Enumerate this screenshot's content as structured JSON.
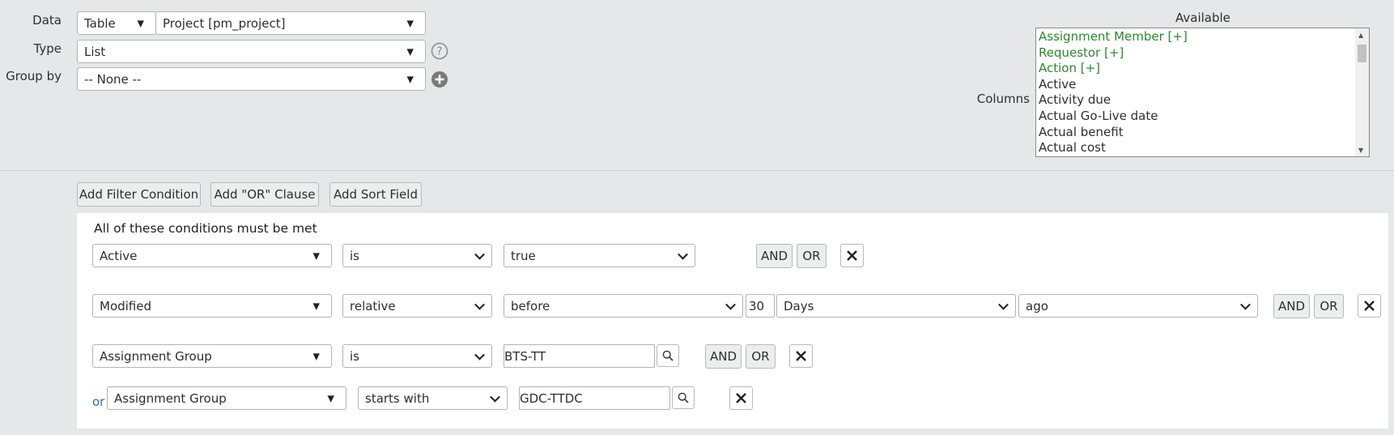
{
  "top": {
    "data": {
      "label": "Data",
      "source_value": "Table",
      "table_value": "Project [pm_project]"
    },
    "type": {
      "label": "Type",
      "value": "List"
    },
    "group_by": {
      "label": "Group by",
      "value": "-- None --"
    }
  },
  "columns": {
    "label": "Columns",
    "available_label": "Available",
    "reference_items": [
      "Assignment Member [+]",
      "Requestor [+]",
      "Action [+]"
    ],
    "items": [
      "Active",
      "Activity due",
      "Actual Go-Live date",
      "Actual benefit",
      "Actual cost"
    ]
  },
  "toolbar": {
    "add_filter": "Add Filter Condition",
    "add_or": "Add \"OR\" Clause",
    "add_sort": "Add Sort Field"
  },
  "filter": {
    "heading": "All of these conditions must be met",
    "and_label": "AND",
    "or_label": "OR",
    "or_prefix": "or",
    "rows": [
      {
        "field": "Active",
        "operator": "is",
        "value": "true"
      },
      {
        "field": "Modified",
        "operator": "relative",
        "value": "before",
        "number": "30",
        "unit": "Days",
        "when": "ago"
      },
      {
        "field": "Assignment Group",
        "operator": "is",
        "value": "BTS-TT"
      },
      {
        "field": "Assignment Group",
        "operator": "starts with",
        "value": "GDC-TTDC"
      }
    ]
  },
  "colors": {
    "reference_field": "#2b8a2b",
    "or_link": "#2a6ebb",
    "background": "#e6e7e9"
  }
}
